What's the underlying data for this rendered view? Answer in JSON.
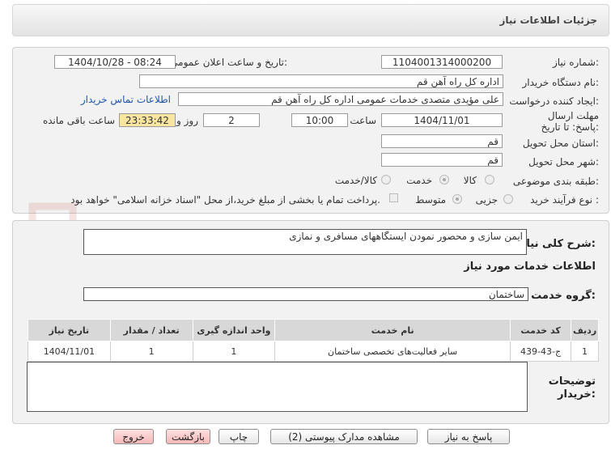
{
  "header": {
    "title": "جزئیات اطلاعات نیاز"
  },
  "form": {
    "need_number_label": "شماره نیاز:",
    "need_number": "1104001314000200",
    "announce_label": "تاریخ و ساعت اعلان عمومی:",
    "announce_value": "1404/10/28 - 08:24",
    "buyer_org_label": "نام دستگاه خریدار:",
    "buyer_org": "اداره کل  راه آهن قم",
    "requester_label": "ایجاد کننده درخواست:",
    "requester": "علی مؤیدی متصدی خدمات عمومی اداره کل  راه آهن قم",
    "contact_link": "اطلاعات تماس خریدار",
    "deadline_label": "مهلت ارسال پاسخ: تا تاریخ:",
    "deadline_date": "1404/11/01",
    "time_label": "ساعت",
    "deadline_time": "10:00",
    "days_value": "2",
    "days_label": "روز و",
    "remaining_time": "23:33:42",
    "remaining_label": "ساعت باقی مانده",
    "province_label": "استان محل تحویل:",
    "province": "قم",
    "city_label": "شهر محل تحویل:",
    "city": "قم",
    "category_label": "طبقه بندی موضوعی:",
    "category_options": [
      "کالا",
      "خدمت",
      "کالا/خدمت"
    ],
    "process_label": "نوع فرآیند خرید :",
    "process_options": [
      "جزیی",
      "متوسط"
    ],
    "payment_note": "پرداخت تمام یا بخشی از مبلغ خرید،از محل \"اسناد خزانه اسلامی\" خواهد بود."
  },
  "details": {
    "summary_label": "شرح کلی نیاز:",
    "summary": "ایمن سازی و محصور نمودن ایستگاههای مسافری و نمازی",
    "services_title": "اطلاعات خدمات مورد نیاز",
    "service_group_label": "گروه خدمت:",
    "service_group": "ساختمان",
    "table": {
      "headers": [
        "ردیف",
        "کد خدمت",
        "نام خدمت",
        "واحد اندازه گیری",
        "تعداد / مقدار",
        "تاریخ نیاز"
      ],
      "rows": [
        [
          "1",
          "ج-43-439",
          "سایر فعالیت‌های تخصصی ساختمان",
          "1",
          "1",
          "1404/11/01"
        ]
      ]
    },
    "buyer_notes_label": "توضیحات خریدار:"
  },
  "watermark_text": "AriaTender.net",
  "buttons": {
    "reply": "پاسخ به نیاز",
    "docs": "مشاهده مدارک پیوستی (2)",
    "print": "چاپ",
    "back": "بازگشت",
    "exit": "خروج"
  }
}
